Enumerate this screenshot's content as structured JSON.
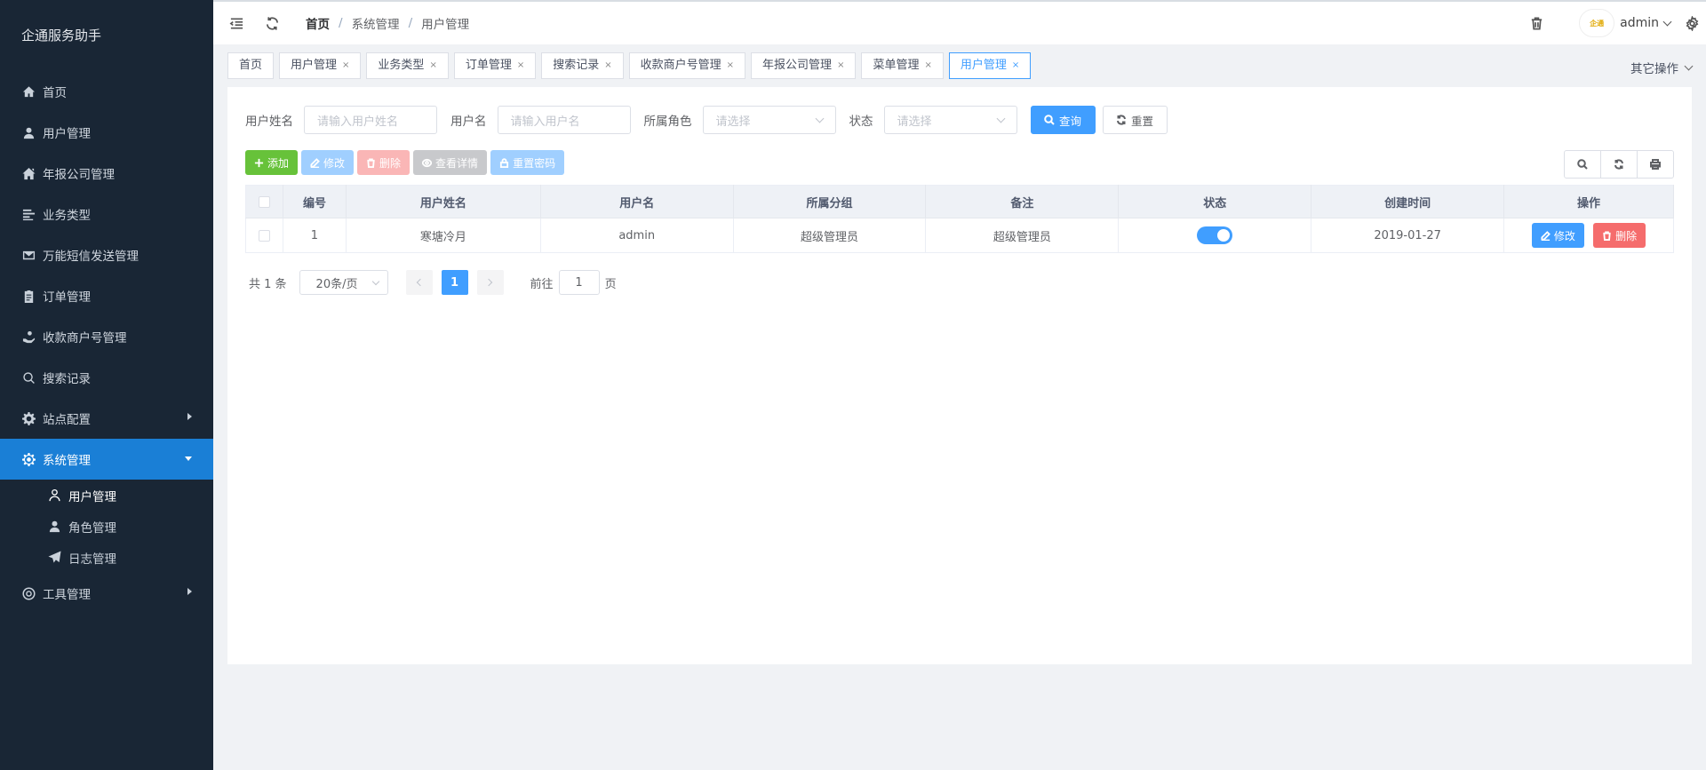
{
  "app": {
    "title": "企通服务助手"
  },
  "sidebar": {
    "items": [
      {
        "label": "首页",
        "icon": "home-icon"
      },
      {
        "label": "用户管理",
        "icon": "user-icon"
      },
      {
        "label": "年报公司管理",
        "icon": "house-icon"
      },
      {
        "label": "业务类型",
        "icon": "list-icon"
      },
      {
        "label": "万能短信发送管理",
        "icon": "mail-icon"
      },
      {
        "label": "订单管理",
        "icon": "clipboard-icon"
      },
      {
        "label": "收款商户号管理",
        "icon": "hand-coin-icon"
      },
      {
        "label": "搜索记录",
        "icon": "search-icon"
      },
      {
        "label": "站点配置",
        "icon": "gear-icon"
      },
      {
        "label": "系统管理",
        "icon": "settings-icon"
      },
      {
        "label": "工具管理",
        "icon": "lifebuoy-icon"
      }
    ],
    "submenu": [
      {
        "label": "用户管理",
        "icon": "user-outline-icon"
      },
      {
        "label": "角色管理",
        "icon": "user-icon"
      },
      {
        "label": "日志管理",
        "icon": "paper-plane-icon"
      }
    ]
  },
  "header": {
    "breadcrumb": [
      "首页",
      "系统管理",
      "用户管理"
    ],
    "username": "admin",
    "avatar_text": "企通"
  },
  "tags": {
    "items": [
      "首页",
      "用户管理",
      "业务类型",
      "订单管理",
      "搜索记录",
      "收款商户号管理",
      "年报公司管理",
      "菜单管理",
      "用户管理"
    ],
    "close": "×",
    "other_ops": "其它操作"
  },
  "search": {
    "name_label": "用户姓名",
    "name_placeholder": "请输入用户姓名",
    "username_label": "用户名",
    "username_placeholder": "请输入用户名",
    "role_label": "所属角色",
    "role_placeholder": "请选择",
    "status_label": "状态",
    "status_placeholder": "请选择",
    "query_btn": "查询",
    "reset_btn": "重置"
  },
  "toolbar": {
    "add": "添加",
    "edit": "修改",
    "delete": "删除",
    "view": "查看详情",
    "reset_pwd": "重置密码"
  },
  "table": {
    "headers": [
      "编号",
      "用户姓名",
      "用户名",
      "所属分组",
      "备注",
      "状态",
      "创建时间",
      "操作"
    ],
    "rows": [
      {
        "id": "1",
        "name": "寒塘冷月",
        "username": "admin",
        "group": "超级管理员",
        "remark": "超级管理员",
        "status": true,
        "created": "2019-01-27",
        "edit": "修改",
        "delete": "删除"
      }
    ]
  },
  "pagination": {
    "total": "共 1 条",
    "page_size": "20条/页",
    "current": "1",
    "goto_prefix": "前往",
    "goto_value": "1",
    "goto_suffix": "页"
  }
}
